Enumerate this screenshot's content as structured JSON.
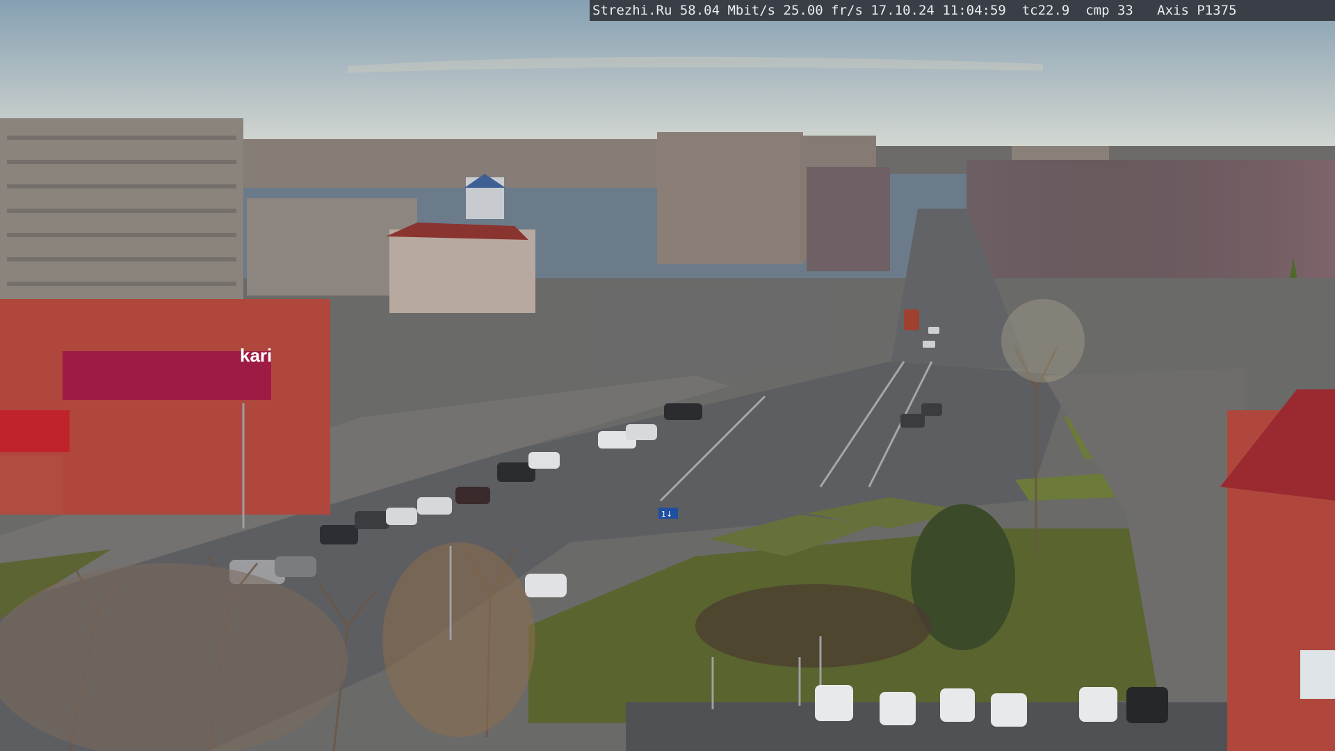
{
  "overlay": {
    "text": "Strezhi.Ru 58.04 Mbit/s 25.00 fr/s 17.10.24 11:04:59  tc22.9  cmp 33   Axis P1375"
  },
  "signs": {
    "store_name": "kari",
    "road_sign": "1↓"
  },
  "colors": {
    "sky_top": "#8ea4b5",
    "sky_bottom": "#cfd6d6",
    "road": "#5c5d60",
    "grass": "#6f7a3f",
    "brick": "#b0473d",
    "panel_building": "#8a8480",
    "store_accent": "#c01e4b"
  }
}
